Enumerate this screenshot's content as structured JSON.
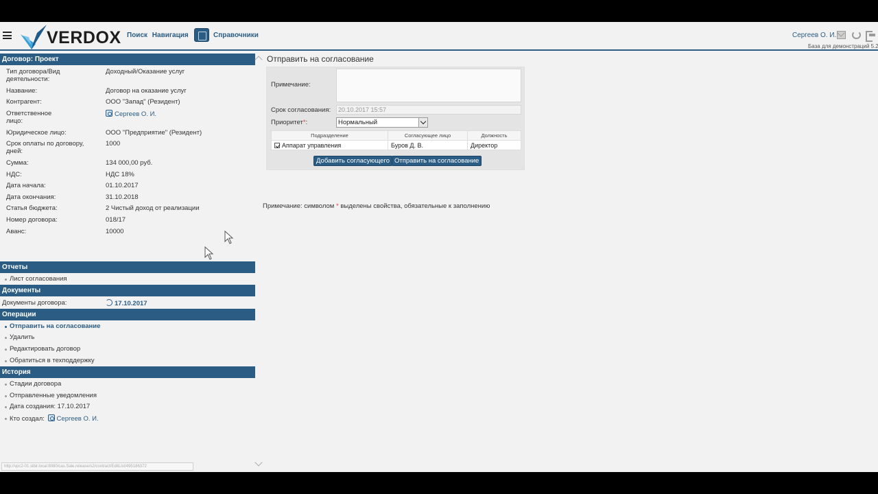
{
  "header": {
    "logo": "VERDOX",
    "nav": [
      "Поиск",
      "Навигация"
    ],
    "nav_references": "Справочники",
    "user": "Сергеев О. И.",
    "db_label": "База для демонстраций 5.2"
  },
  "sidebar": {
    "contract_title": "Договор: Проект",
    "fields": [
      {
        "label": "Тип договора/Вид деятельности:",
        "value": "Доходный/Оказание услуг"
      },
      {
        "label": "Название:",
        "value": "Договор на оказание услуг"
      },
      {
        "label": "Контрагент:",
        "value": "ООО \"Запад\" (Резидент)"
      },
      {
        "label": "Ответственное лицо:",
        "value": "Сергеев О. И."
      },
      {
        "label": "Юридическое лицо:",
        "value": "ООО \"Предприятие\" (Резидент)"
      },
      {
        "label": "Срок оплаты по договору, дней:",
        "value": "1000"
      },
      {
        "label": "Сумма:",
        "value": "134 000,00 руб."
      },
      {
        "label": "НДС:",
        "value": "НДС 18%"
      },
      {
        "label": "Дата начала:",
        "value": "01.10.2017"
      },
      {
        "label": "Дата окончания:",
        "value": "31.10.2018"
      },
      {
        "label": "Статья бюджета:",
        "value": "2 Чистый доход от реализации"
      },
      {
        "label": "Номер договора:",
        "value": "018/17"
      },
      {
        "label": "Аванс:",
        "value": "10000"
      }
    ],
    "reports_title": "Отчеты",
    "reports_items": [
      "Лист согласования"
    ],
    "documents_title": "Документы",
    "documents_label": "Документы договора:",
    "documents_value": "17.10.2017",
    "operations_title": "Операции",
    "operations": [
      "Отправить на согласование",
      "Удалить",
      "Редактировать договор",
      "Обратиться в техподдержку"
    ],
    "history_title": "История",
    "history": [
      "Стадии договора",
      "Отправленные уведомления",
      "Дата создания: 17.10.2017"
    ],
    "created_by_label": "Кто создал:",
    "created_by_value": "Сергеев О. И.",
    "status_url": "http://vpc2-01.sibir.local:8080/cas.Sale.release/s2/contract/EditList/495186372"
  },
  "main": {
    "title": "Отправить на согласование",
    "note_label": "Примечание:",
    "deadline_label": "Срок согласования:",
    "deadline_value": "20.10.2017 15:57",
    "priority_label": "Приоритет",
    "priority_required": "*",
    "priority_colon": ":",
    "priority_value": "Нормальный",
    "table_headers": [
      "Подразделение",
      "Согласующее лицо",
      "Должность"
    ],
    "table_rows": [
      {
        "department": "Аппарат управления",
        "person": "Буров Д. В.",
        "position": "Директор"
      }
    ],
    "btn_add": "Добавить согласующего",
    "btn_send": "Отправить на согласование",
    "footnote_prefix": "Примечание: символом",
    "footnote_star": "*",
    "footnote_suffix": "выделены свойства, обязательные к заполнению"
  },
  "colors": {
    "accent": "#2a5c84",
    "required": "#e04040"
  }
}
